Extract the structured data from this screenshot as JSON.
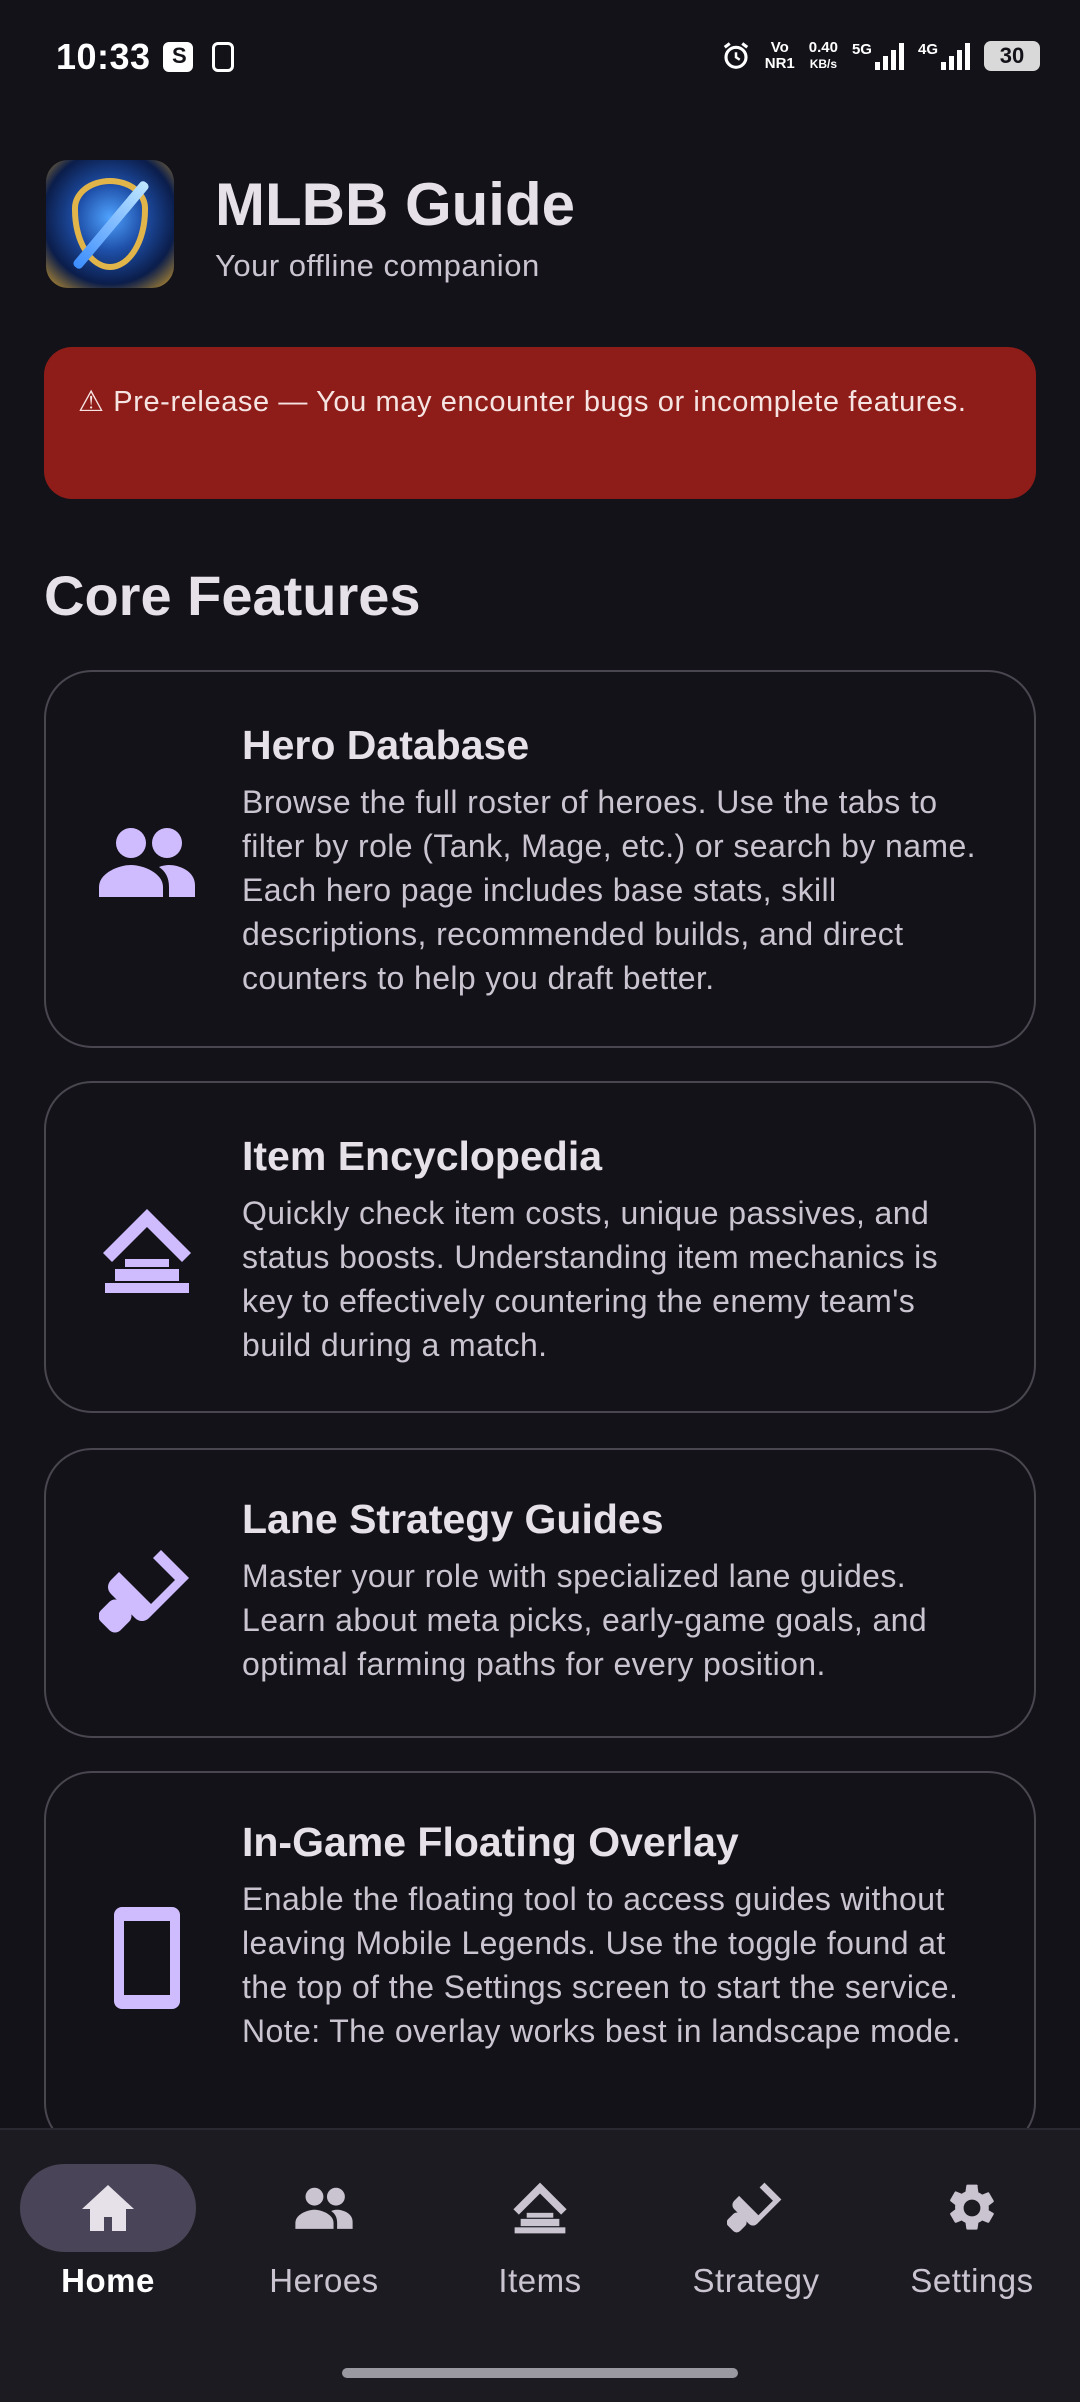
{
  "status_bar": {
    "time": "10:33",
    "volte_top": "Vo",
    "volte_bottom": "NR1",
    "speed_value": "0.40",
    "speed_unit": "KB/s",
    "network_1": "5G",
    "network_2": "4G",
    "battery": "30"
  },
  "header": {
    "title": "MLBB Guide",
    "subtitle": "Your offline companion",
    "logo_icon": "app-logo-shield-sword"
  },
  "banner": {
    "text": "⚠ Pre-release — You may encounter bugs or incomplete features.",
    "color": "#8E1D19"
  },
  "section": {
    "title": "Core Features"
  },
  "features": [
    {
      "icon": "group-icon",
      "title": "Hero Database",
      "description": "Browse the full roster of heroes. Use the tabs to filter by role (Tank, Mage, etc.) or search by name. Each hero page includes base stats, skill descriptions, recommended builds, and direct counters to help you draft better."
    },
    {
      "icon": "upgrade-icon",
      "title": "Item Encyclopedia",
      "description": "Quickly check item costs, unique passives, and status boosts. Understanding item mechanics is key to effectively countering the enemy team's build during a match."
    },
    {
      "icon": "strategy-icon",
      "title": "Lane Strategy Guides",
      "description": "Master your role with specialized lane guides. Learn about meta picks, early-game goals, and optimal farming paths for every position."
    },
    {
      "icon": "phone-icon",
      "title": "In-Game Floating Overlay",
      "description": "Enable the floating tool to access guides without leaving Mobile Legends. Use the toggle found at the top of the Settings screen to start the service. Note: The overlay works best in landscape mode."
    }
  ],
  "bottom_nav": {
    "items": [
      {
        "label": "Home",
        "icon": "home-icon",
        "active": true
      },
      {
        "label": "Heroes",
        "icon": "group-icon",
        "active": false
      },
      {
        "label": "Items",
        "icon": "upgrade-icon",
        "active": false
      },
      {
        "label": "Strategy",
        "icon": "strategy-icon",
        "active": false
      },
      {
        "label": "Settings",
        "icon": "gear-icon",
        "active": false
      }
    ]
  },
  "colors": {
    "background": "#131218",
    "accent": "#CFBCFF",
    "active_pill": "#4A4458"
  }
}
